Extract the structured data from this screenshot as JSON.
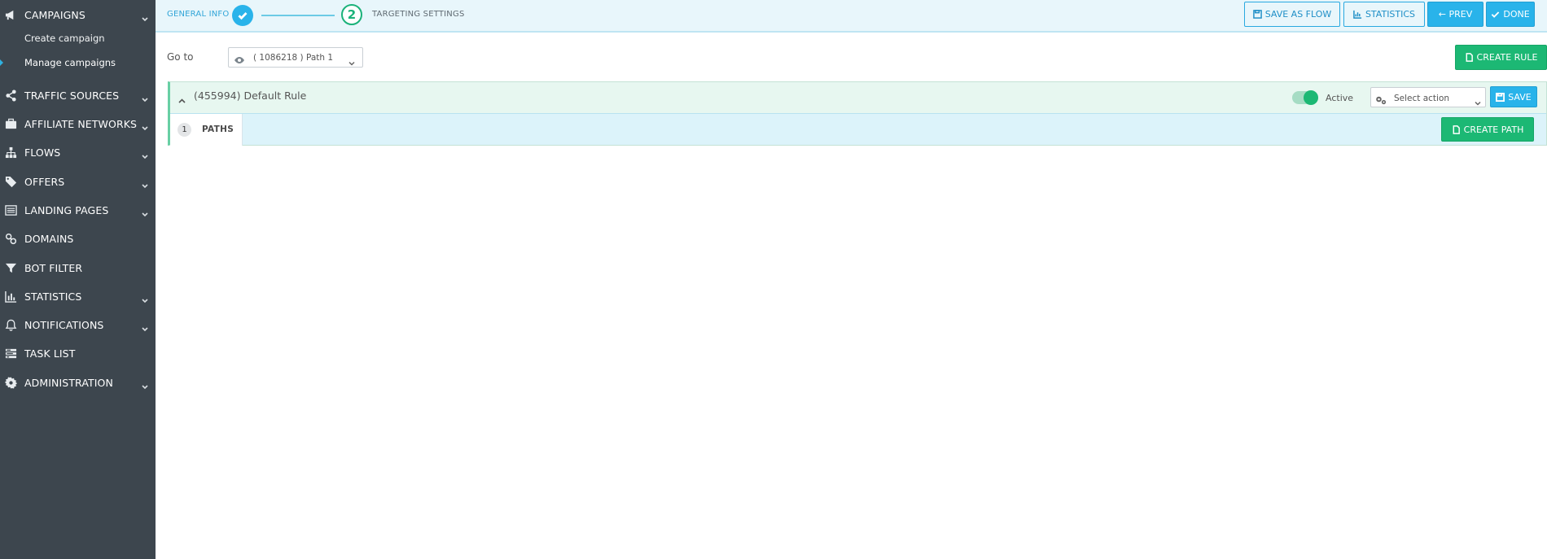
{
  "sidebar": {
    "items": [
      {
        "label": "CAMPAIGNS",
        "icon": "megaphone-icon"
      },
      {
        "label": "TRAFFIC SOURCES",
        "icon": "share-icon"
      },
      {
        "label": "AFFILIATE NETWORKS",
        "icon": "briefcase-icon"
      },
      {
        "label": "FLOWS",
        "icon": "sitemap-icon"
      },
      {
        "label": "OFFERS",
        "icon": "tags-icon"
      },
      {
        "label": "LANDING PAGES",
        "icon": "list-alt-icon"
      },
      {
        "label": "DOMAINS",
        "icon": "link-icon"
      },
      {
        "label": "BOT FILTER",
        "icon": "filter-icon"
      },
      {
        "label": "STATISTICS",
        "icon": "bar-chart-icon"
      },
      {
        "label": "NOTIFICATIONS",
        "icon": "bell-icon"
      },
      {
        "label": "TASK LIST",
        "icon": "tasks-icon"
      },
      {
        "label": "ADMINISTRATION",
        "icon": "gear-icon"
      }
    ],
    "campaigns_sub": {
      "create": "Create campaign",
      "manage": "Manage campaigns"
    },
    "active_item": "Manage campaigns"
  },
  "wizard": {
    "step1_label": "GENERAL INFO",
    "step2_number": "2",
    "step2_label": "TARGETING SETTINGS"
  },
  "toolbar": {
    "save_as_flow": "SAVE AS FLOW",
    "statistics": "STATISTICS",
    "prev": "← PREV",
    "done": "DONE"
  },
  "goto": {
    "label": "Go to",
    "selected": "( 1086218 ) Path 1"
  },
  "create_rule": "CREATE RULE",
  "rule": {
    "title": "(455994) Default Rule",
    "status_label": "Active",
    "status_on": true,
    "action_placeholder": "Select action",
    "save": "SAVE",
    "paths_count": "1",
    "paths_label": "PATHS",
    "create_path": "CREATE PATH"
  },
  "colors": {
    "sidebar_bg": "#3d464e",
    "accent_blue": "#29b3ea",
    "accent_green": "#1cb874",
    "topbar_bg": "#e8f6fb",
    "rule_bg": "#e7f7f0",
    "paths_bg": "#dcf3fa"
  }
}
